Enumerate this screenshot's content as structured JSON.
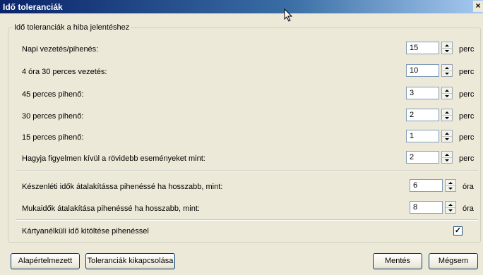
{
  "window": {
    "title": "Idő toleranciák",
    "close_label": "×"
  },
  "group": {
    "legend": "Idő toleranciák a hiba jelentéshez"
  },
  "rows": [
    {
      "label": "Napi vezetés/pihenés:",
      "value": "15",
      "unit": "perc"
    },
    {
      "label": "4 óra 30 perces vezetés:",
      "value": "10",
      "unit": "perc"
    },
    {
      "label": "45 perces pihenő:",
      "value": "3",
      "unit": "perc"
    },
    {
      "label": "30 perces pihenő:",
      "value": "2",
      "unit": "perc"
    },
    {
      "label": "15 perces pihenő:",
      "value": "1",
      "unit": "perc"
    },
    {
      "label": "Hagyja figyelmen kívül a rövidebb eseményeket mint:",
      "value": "2",
      "unit": "perc"
    },
    {
      "label": "Készenléti idők átalakítássa pihenéssé ha hosszabb, mint:",
      "value": "6",
      "unit": "óra"
    },
    {
      "label": "Mukaidők átalakítása pihenéssé ha hosszabb, mint:",
      "value": "8",
      "unit": "óra"
    }
  ],
  "checkbox": {
    "label": "Kártyanélküli idő kitöltése pihenéssel",
    "checked": true,
    "mark": "✓"
  },
  "buttons": {
    "defaults": "Alapértelmezett",
    "disable": "Toleranciák kikapcsolása",
    "save": "Mentés",
    "cancel": "Mégsem"
  }
}
